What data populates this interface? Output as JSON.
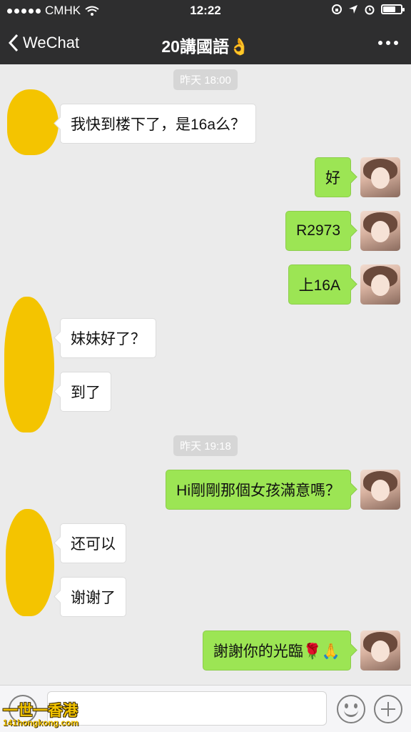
{
  "status_bar": {
    "carrier": "CMHK",
    "time": "12:22"
  },
  "nav": {
    "back_label": "WeChat",
    "title": "20講國語👌"
  },
  "messages": {
    "ts1": "昨天 18:00",
    "m1": "我快到楼下了，是16a么？",
    "m2": "好",
    "m3": "R2973",
    "m4": "上16A",
    "m5": "妹妹好了？",
    "m6": "到了",
    "ts2": "昨天 19:18",
    "m7": "Hi剛剛那個女孩滿意嗎？",
    "m8": "还可以",
    "m9": "谢谢了",
    "m10": "謝謝你的光臨🌹🙏"
  },
  "input_bar": {
    "text_value": ""
  },
  "watermark": {
    "line1": "一世一香港",
    "line2": "141hongkong.com"
  },
  "colors": {
    "header_bg": "#2e2e2f",
    "chat_bg": "#ebebeb",
    "outgoing_bubble": "#9ce554",
    "incoming_bubble": "#ffffff",
    "redaction": "#f4c400"
  }
}
